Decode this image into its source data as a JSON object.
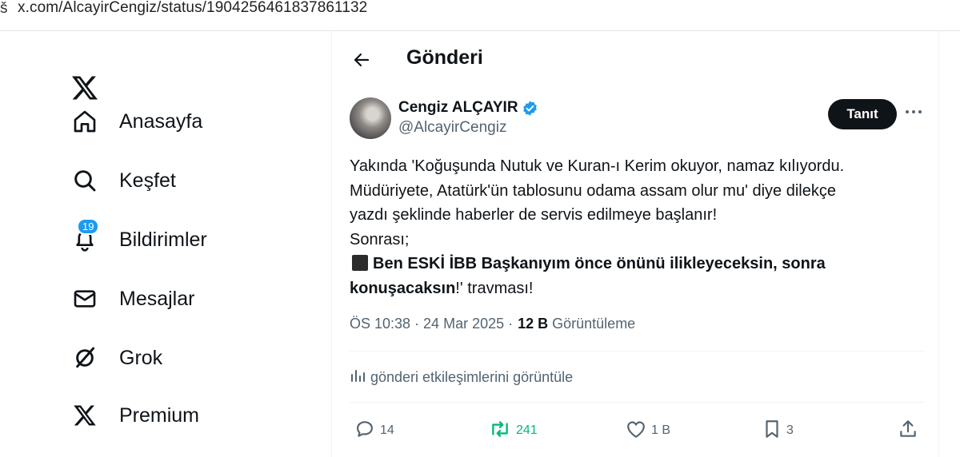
{
  "browser": {
    "lead_glyph": "š",
    "url": "x.com/AlcayirCengiz/status/1904256461837861132"
  },
  "nav": {
    "items": [
      {
        "label": "Anasayfa",
        "icon": "home-icon"
      },
      {
        "label": "Keşfet",
        "icon": "search-icon"
      },
      {
        "label": "Bildirimler",
        "icon": "bell-icon",
        "badge": "19"
      },
      {
        "label": "Mesajlar",
        "icon": "envelope-icon"
      },
      {
        "label": "Grok",
        "icon": "grok-icon"
      },
      {
        "label": "Premium",
        "icon": "x-logo-icon"
      }
    ]
  },
  "header": {
    "title": "Gönderi"
  },
  "tweet": {
    "author_name": "Cengiz ALÇAYIR",
    "author_handle": "@AlcayirCengiz",
    "follow_label": "Tanıt",
    "text": {
      "l1": "Yakında 'Koğuşunda Nutuk ve Kuran-ı Kerim okuyor, namaz kılıyordu.",
      "l2": "Müdüriyete, Atatürk'ün tablosunu odama assam olur mu' diye dilekçe",
      "l3": "yazdı şeklinde haberler de servis edilmeye başlanır!",
      "l4": "Sonrası;",
      "l5_bold": "Ben ESKİ İBB Başkanıyım önce önünü ilikleyeceksin, sonra",
      "l6_bold": "konuşacaksın",
      "l6_rest": "!' travması!"
    },
    "timestamp": "ÖS 10:38 · 24 Mar 2025 ·",
    "views_count": "12 B",
    "views_label": "Görüntüleme",
    "engagements_label": "gönderi etkileşimlerini görüntüle",
    "replies": "14",
    "reposts": "241",
    "likes": "1 B",
    "bookmarks": "3"
  },
  "colors": {
    "accent": "#1d9bf0",
    "repost_green": "#00ba7c",
    "text": "#0f1419",
    "muted": "#536471"
  }
}
